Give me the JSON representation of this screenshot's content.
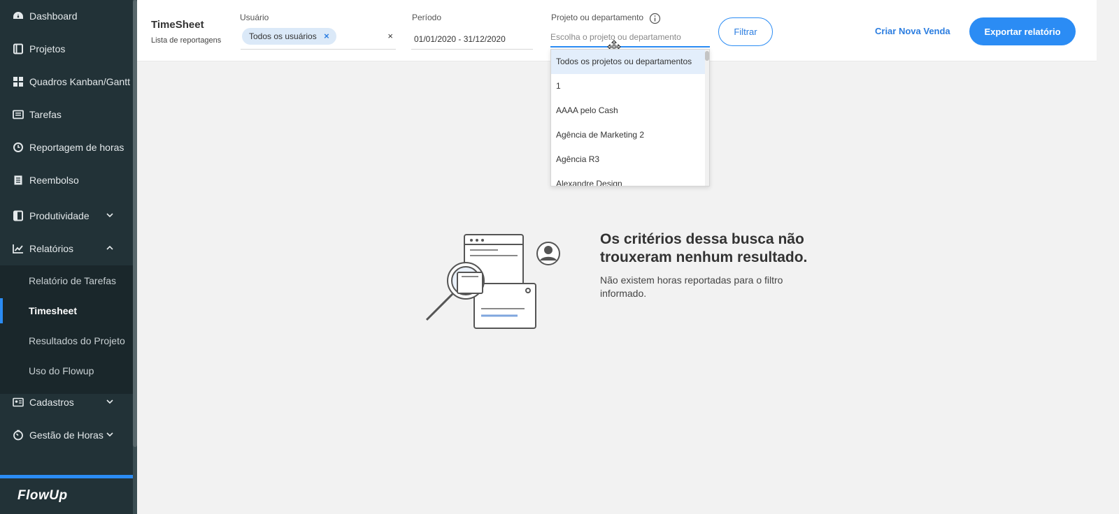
{
  "sidebar": {
    "items": [
      {
        "label": "Dashboard",
        "icon": "dashboard-icon"
      },
      {
        "label": "Projetos",
        "icon": "book-icon"
      },
      {
        "label": "Quadros Kanban/Gantt",
        "icon": "grid-icon"
      },
      {
        "label": "Tarefas",
        "icon": "list-icon"
      },
      {
        "label": "Reportagem de horas",
        "icon": "clock-icon"
      },
      {
        "label": "Reembolso",
        "icon": "receipt-icon"
      },
      {
        "label": "Produtividade",
        "icon": "chart-book-icon"
      },
      {
        "label": "Relatórios",
        "icon": "line-chart-icon"
      },
      {
        "label": "Cadastros",
        "icon": "id-card-icon"
      },
      {
        "label": "Gestão de Horas",
        "icon": "timer-icon"
      }
    ],
    "submenu": [
      {
        "label": "Relatório de Tarefas"
      },
      {
        "label": "Timesheet"
      },
      {
        "label": "Resultados do Projeto"
      },
      {
        "label": "Uso do Flowup"
      }
    ],
    "logo": "FlowUp"
  },
  "header": {
    "title": "TimeSheet",
    "subtitle": "Lista de reportagens",
    "user_label": "Usuário",
    "user_chip": "Todos os usuários",
    "chip_remove": "×",
    "clear": "×",
    "period_label": "Período",
    "period_value": "01/01/2020 - 31/12/2020",
    "project_label": "Projeto ou departamento",
    "project_placeholder": "Escolha o projeto ou departamento",
    "filter_button": "Filtrar",
    "new_sale_link": "Criar Nova Venda",
    "export_button": "Exportar relatório"
  },
  "dropdown": {
    "options": [
      "Todos os projetos ou departamentos",
      "1",
      "AAAA pelo Cash",
      "Agência de Marketing 2",
      "Agência R3",
      "Alexandre Design"
    ]
  },
  "empty_state": {
    "title": "Os critérios dessa busca não trouxeram nenhum resultado.",
    "description": "Não existem horas reportadas para o filtro informado."
  },
  "colors": {
    "sidebar_bg": "#223237",
    "accent": "#2b8cf4",
    "page_bg": "#f2f2f2"
  }
}
